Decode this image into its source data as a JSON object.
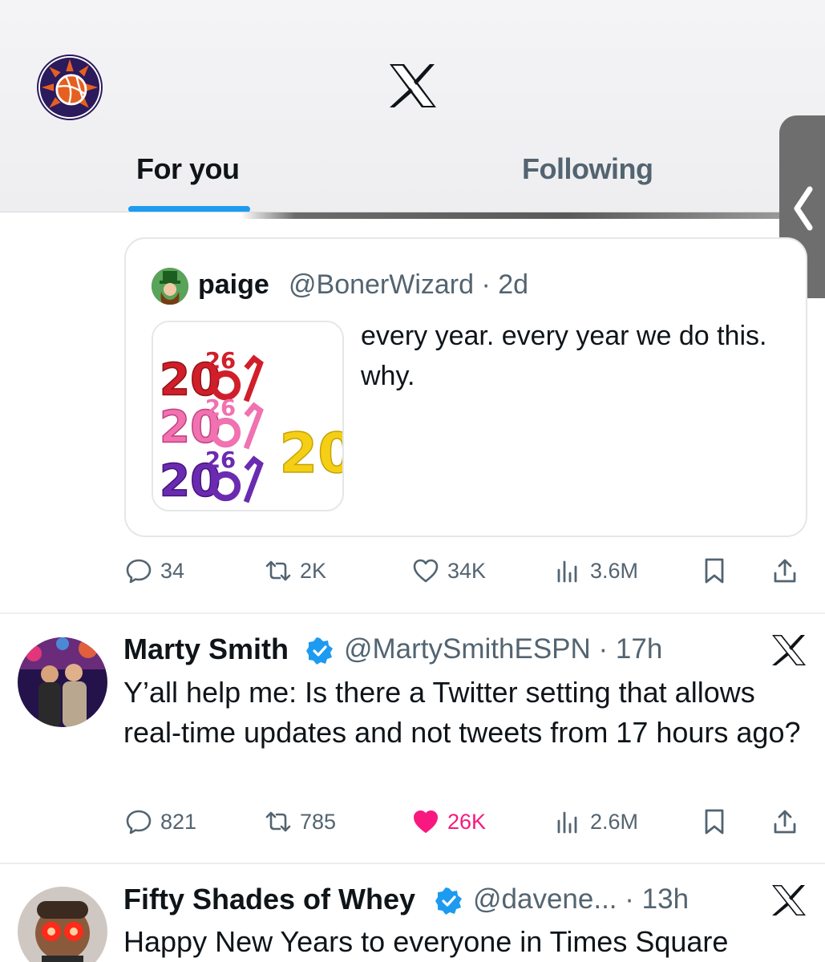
{
  "header": {
    "logo": "x-logo",
    "profile_avatar": "suns-basketball-logo",
    "tabs": [
      {
        "label": "For you",
        "active": true
      },
      {
        "label": "Following",
        "active": false
      }
    ],
    "side_handle_icon": "chevron-left-icon",
    "accent_color": "#1d9bf0"
  },
  "quote": {
    "name": "paige",
    "handle": "@BonerWizard · 2d",
    "text": "every year. every year we do this. why.",
    "media": "2026 novelty glasses image"
  },
  "tweet1_actions": {
    "replies": "34",
    "reposts": "2K",
    "likes": "34K",
    "views": "3.6M"
  },
  "tweet2": {
    "name": "Marty Smith",
    "handle": "@MartySmithESPN · 17h",
    "verified": true,
    "text": "Y’all help me: Is there a Twitter setting that allows real-time updates and not tweets from 17 hours ago?",
    "replies": "821",
    "reposts": "785",
    "likes": "26K",
    "liked": true,
    "views": "2.6M"
  },
  "tweet3": {
    "name": "Fifty Shades of Whey",
    "handle": "@davene... · 13h",
    "verified": true,
    "text": "Happy New Years to everyone in Times Square"
  },
  "colors": {
    "text_primary": "#0f1419",
    "text_secondary": "#536471",
    "like_pink": "#f91880",
    "verified_blue": "#1d9bf0"
  }
}
